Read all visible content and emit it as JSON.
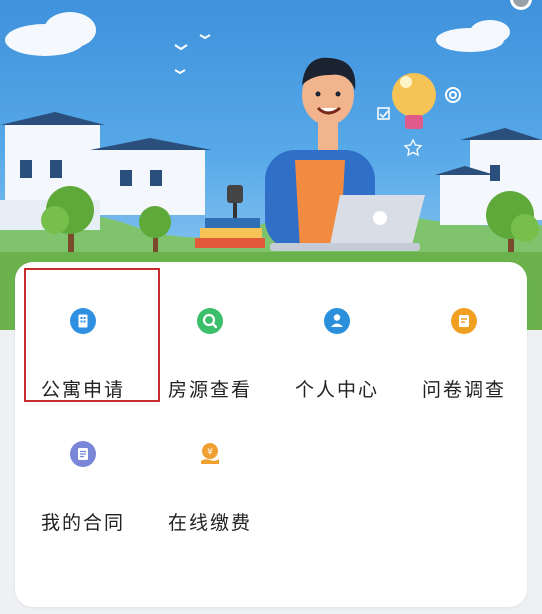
{
  "grid": {
    "items": [
      {
        "label": "公寓申请",
        "icon": "apartment-icon",
        "color": "#2f8fe0"
      },
      {
        "label": "房源查看",
        "icon": "search-icon",
        "color": "#3cbf6a"
      },
      {
        "label": "个人中心",
        "icon": "user-center-icon",
        "color": "#2c8fdc"
      },
      {
        "label": "问卷调查",
        "icon": "questionnaire-icon",
        "color": "#f0a020"
      },
      {
        "label": "我的合同",
        "icon": "contract-icon",
        "color": "#7a86d8"
      },
      {
        "label": "在线缴费",
        "icon": "payment-icon",
        "color": "#f0a030"
      }
    ]
  },
  "colors": {
    "highlight": "#c62d2d",
    "banner_sky": "#4a9ce2"
  }
}
